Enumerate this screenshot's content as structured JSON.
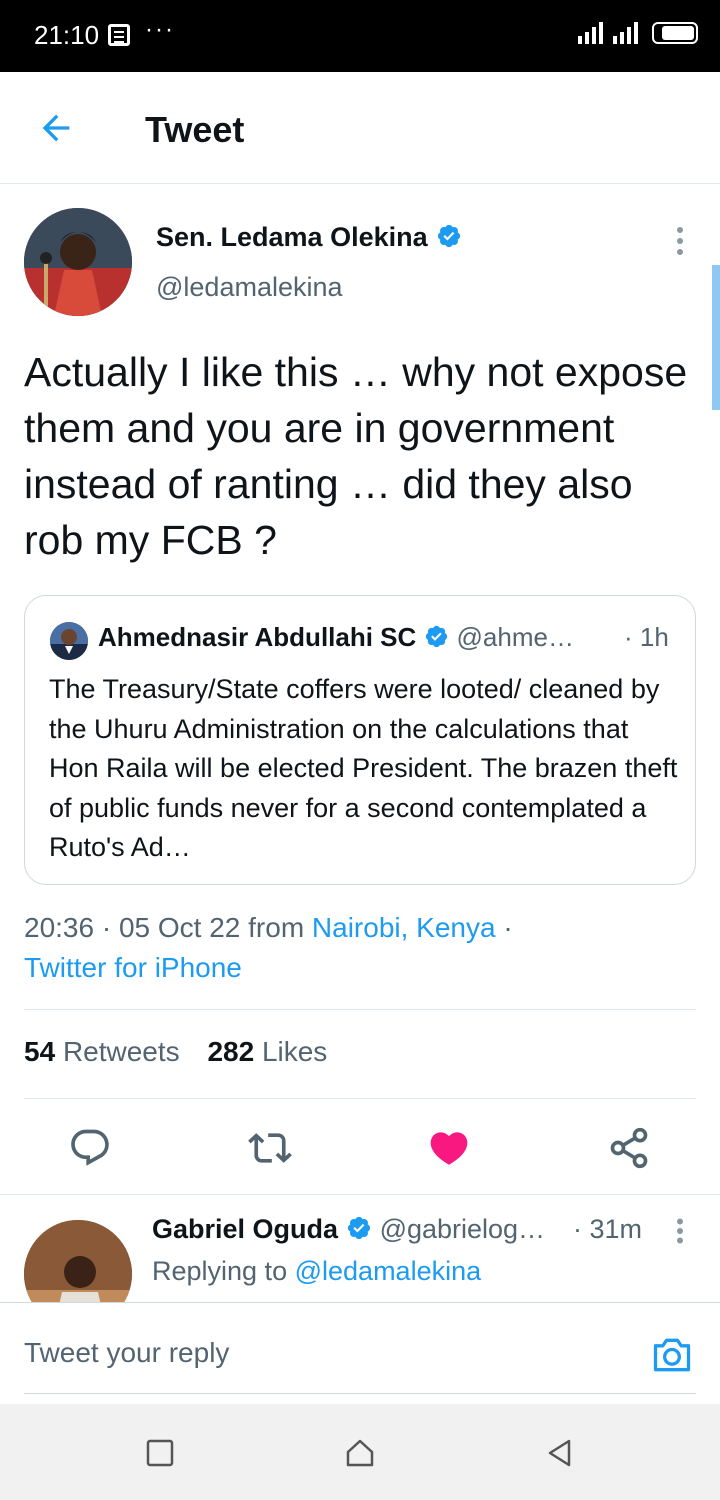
{
  "status_bar": {
    "time": "21:10",
    "overflow": "···"
  },
  "header": {
    "title": "Tweet"
  },
  "tweet": {
    "author_name": "Sen. Ledama Olekina",
    "author_handle": "@ledamalekina",
    "text": "Actually I like this … why not expose them and you are in government instead of ranting … did they also rob my FCB ?",
    "quote": {
      "author_name": "Ahmednasir Abdullahi SC",
      "author_handle": "@ahme…",
      "time": "· 1h",
      "text": "The Treasury/State coffers were looted/ cleaned by the Uhuru Administration on the calculations that Hon Raila will be elected President. The brazen theft of public funds never for a second contemplated a Ruto's Ad…"
    },
    "timestamp": "20:36 · 05 Oct 22 from",
    "location": "Nairobi, Kenya",
    "separator": "·",
    "source": "Twitter for iPhone",
    "retweets_count": "54",
    "retweets_label": "Retweets",
    "likes_count": "282",
    "likes_label": "Likes"
  },
  "reply": {
    "author_name": "Gabriel Oguda",
    "author_handle": "@gabrielog…",
    "time": "· 31m",
    "replying_prefix": "Replying to",
    "replying_handle": "@ledamalekina"
  },
  "compose": {
    "placeholder": "Tweet your reply"
  },
  "colors": {
    "accent": "#1d9bf0",
    "like": "#f91880",
    "text": "#0f1419",
    "muted": "#536471"
  },
  "icons": [
    "back-arrow-icon",
    "verified-icon",
    "more-icon",
    "reply-icon",
    "retweet-icon",
    "like-icon",
    "share-icon",
    "camera-icon",
    "nav-square-icon",
    "nav-home-icon",
    "nav-back-icon"
  ]
}
